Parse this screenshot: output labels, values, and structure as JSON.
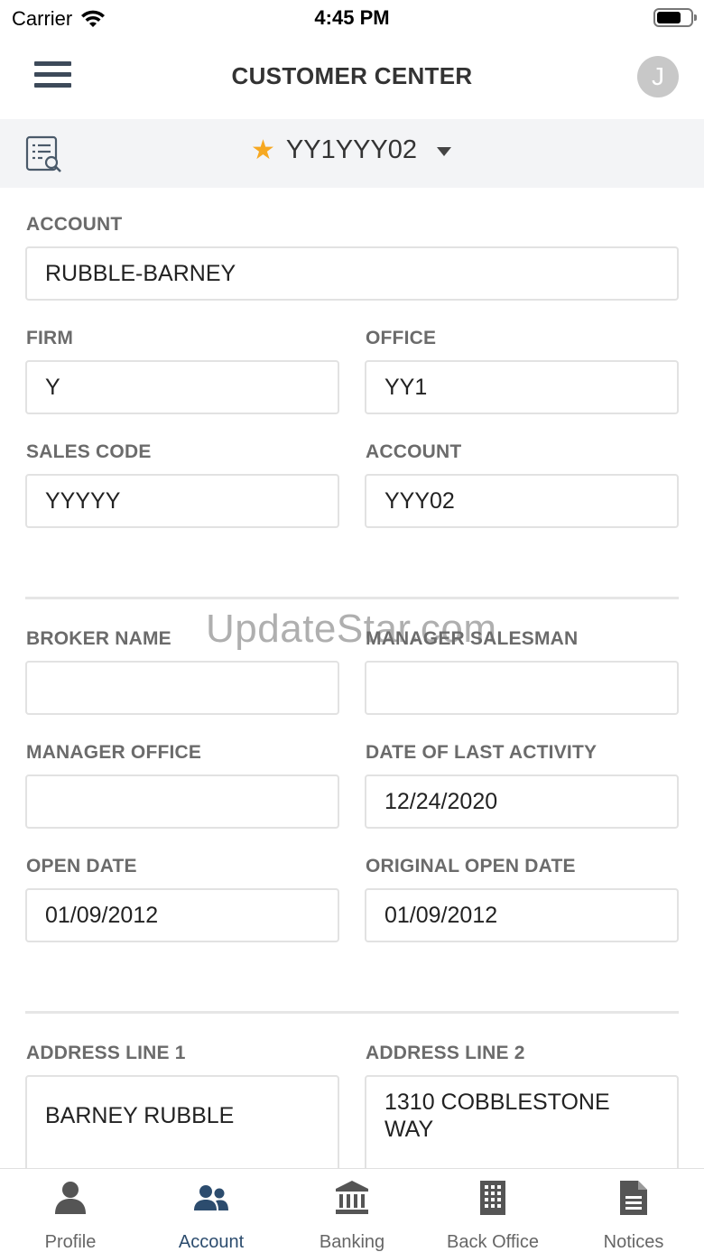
{
  "status_bar": {
    "carrier": "Carrier",
    "time": "4:45 PM"
  },
  "header": {
    "title": "CUSTOMER CENTER",
    "avatar_initial": "J"
  },
  "account_bar": {
    "account_id": "YY1YYY02"
  },
  "fields": {
    "account_name": {
      "label": "ACCOUNT",
      "value": "RUBBLE-BARNEY"
    },
    "firm": {
      "label": "FIRM",
      "value": "Y"
    },
    "office": {
      "label": "OFFICE",
      "value": "YY1"
    },
    "sales_code": {
      "label": "SALES CODE",
      "value": "YYYYY"
    },
    "account": {
      "label": "ACCOUNT",
      "value": "YYY02"
    },
    "broker_name": {
      "label": "BROKER NAME",
      "value": ""
    },
    "manager_salesman": {
      "label": "MANAGER SALESMAN",
      "value": ""
    },
    "manager_office": {
      "label": "MANAGER OFFICE",
      "value": ""
    },
    "date_last_activity": {
      "label": "DATE OF LAST ACTIVITY",
      "value": "12/24/2020"
    },
    "open_date": {
      "label": "OPEN DATE",
      "value": "01/09/2012"
    },
    "original_open_date": {
      "label": "ORIGINAL OPEN DATE",
      "value": "01/09/2012"
    },
    "address_line_1": {
      "label": "ADDRESS LINE 1",
      "value": "BARNEY RUBBLE"
    },
    "address_line_2": {
      "label": "ADDRESS LINE 2",
      "value": "1310 COBBLESTONE WAY"
    }
  },
  "watermark": "UpdateStar.com",
  "tabs": [
    {
      "label": "Profile",
      "icon": "person-icon",
      "active": false
    },
    {
      "label": "Account",
      "icon": "people-icon",
      "active": true
    },
    {
      "label": "Banking",
      "icon": "bank-icon",
      "active": false
    },
    {
      "label": "Back Office",
      "icon": "building-icon",
      "active": false
    },
    {
      "label": "Notices",
      "icon": "document-icon",
      "active": false
    }
  ],
  "colors": {
    "accent": "#2c4c6e",
    "star": "#f6a821",
    "label": "#6b6b6b",
    "header_icon": "#3d4a5a"
  }
}
